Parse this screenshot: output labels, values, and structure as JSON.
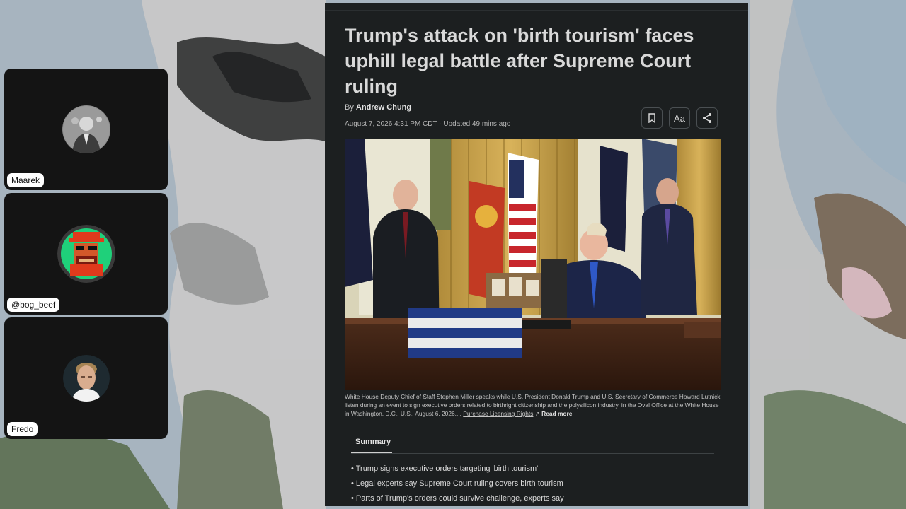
{
  "participants": [
    {
      "name": "Maarek"
    },
    {
      "name": "@bog_beef"
    },
    {
      "name": "Fredo"
    }
  ],
  "article": {
    "headline": "Trump's attack on 'birth tourism' faces uphill legal battle after Supreme Court ruling",
    "byline_prefix": "By",
    "author": "Andrew Chung",
    "dateline": "August 7, 2026 4:31 PM CDT · Updated 49 mins ago",
    "tools": {
      "font_label": "Aa",
      "icons": [
        "bookmark-icon",
        "share-icon"
      ]
    },
    "caption": {
      "text": "White House Deputy Chief of Staff Stephen Miller speaks while U.S. President Donald Trump and U.S. Secretary of Commerce Howard Lutnick listen during an event to sign executive orders related to birthright citizenship and the polysilicon industry, in the Oval Office at the White House in Washington, D.C., U.S., August 6, 2026....",
      "license_link": "Purchase Licensing Rights",
      "read_more": "Read more"
    },
    "summary": {
      "tab_label": "Summary",
      "items": [
        "Trump signs executive orders targeting 'birth tourism'",
        "Legal experts say Supreme Court ruling covers birth tourism",
        "Parts of Trump's orders could survive challenge, experts say"
      ]
    }
  },
  "colors": {
    "panel_bg": "#1c1f20",
    "tile_bg": "#141414",
    "headline": "#d9d9d9"
  }
}
